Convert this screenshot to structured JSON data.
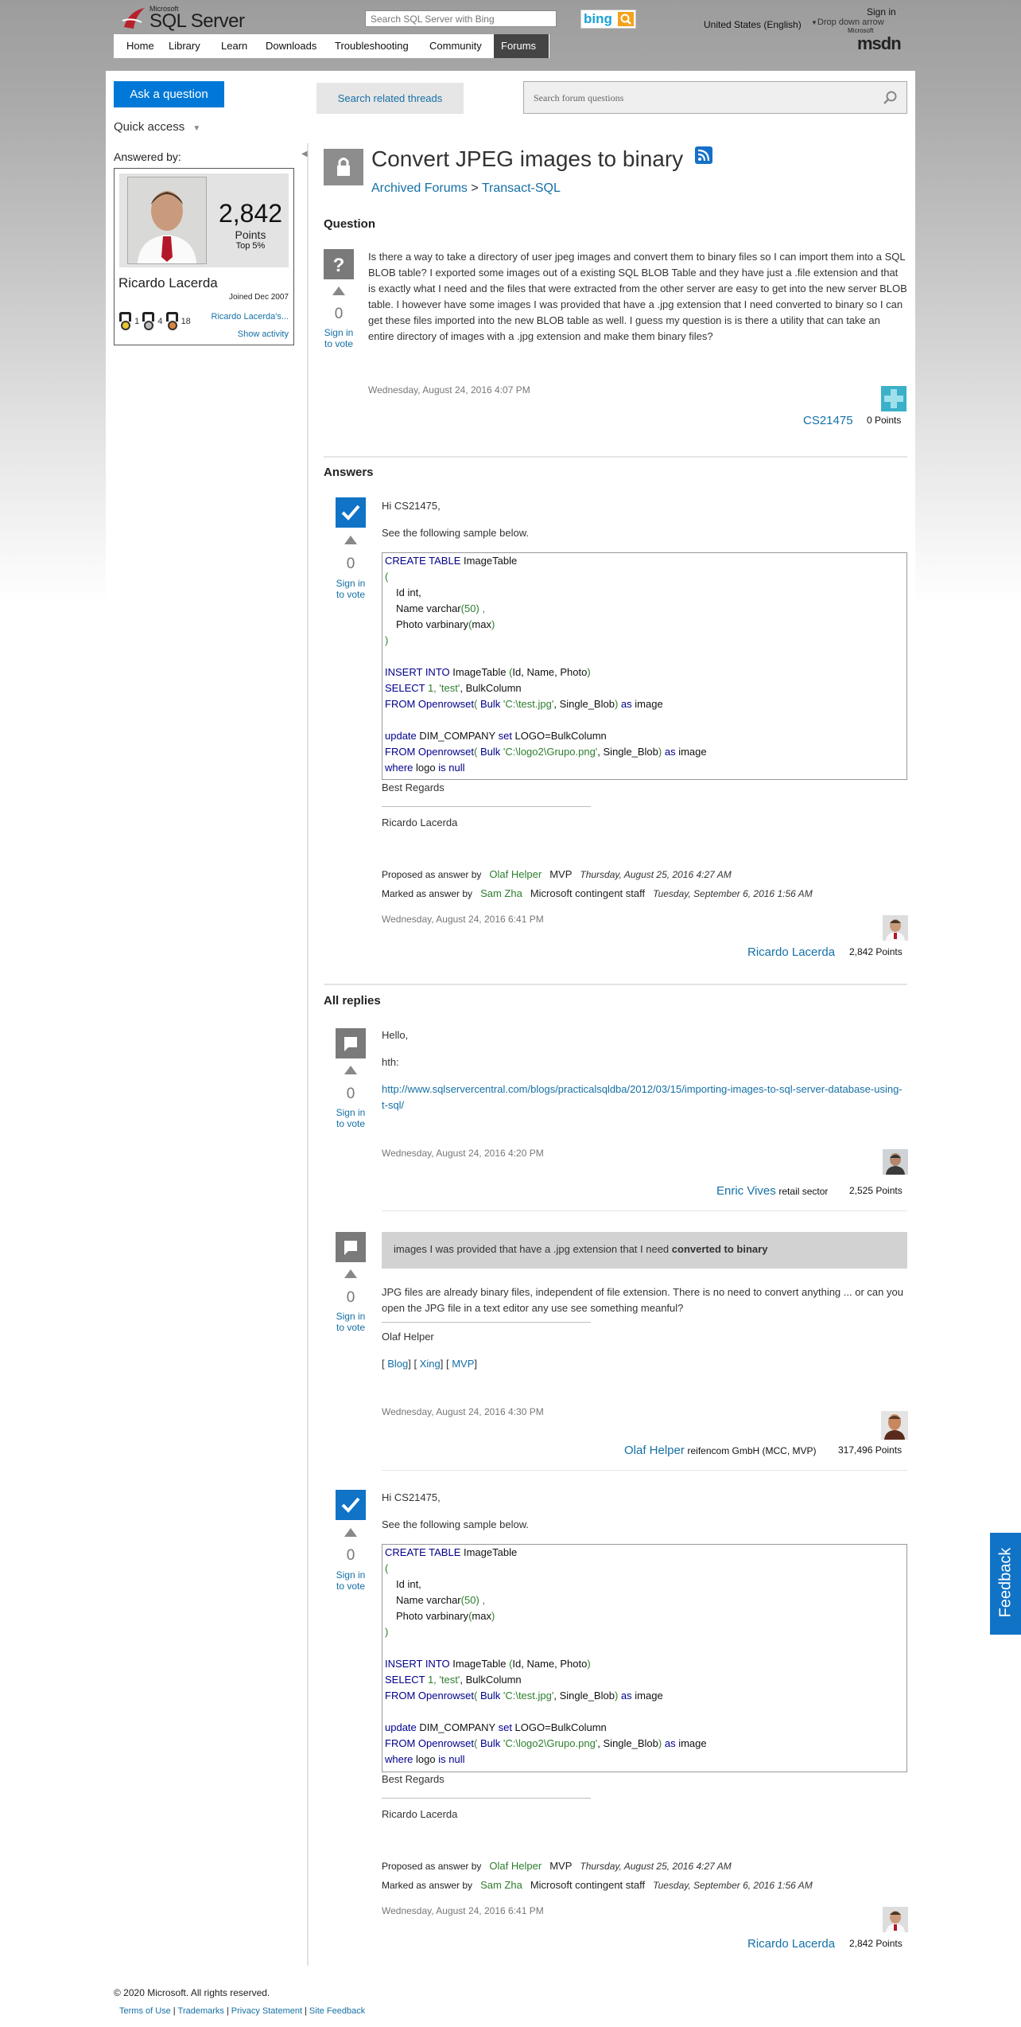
{
  "header": {
    "brand_small": "Microsoft",
    "brand": "SQL Server",
    "search_placeholder": "Search SQL Server with Bing",
    "bing_label": "bing",
    "signin": "Sign in",
    "locale": "United States (English)",
    "dropdown_alt": "Drop down arrow",
    "msdn_small": "Microsoft",
    "msdn": "msdn"
  },
  "nav": [
    "Home",
    "Library",
    "Learn",
    "Downloads",
    "Troubleshooting",
    "Community",
    "Forums"
  ],
  "toolbar": {
    "ask": "Ask a question",
    "search_threads": "Search related threads",
    "forum_search_placeholder": "Search forum questions",
    "quick_access": "Quick access"
  },
  "answered_by": {
    "label": "Answered by:",
    "points": "2,842",
    "points_label": "Points",
    "top": "Top 5%",
    "name": "Ricardo Lacerda",
    "joined": "Joined Dec 2007",
    "medals": [
      "1",
      "4",
      "18"
    ],
    "profile_link": "Ricardo Lacerda's...",
    "show_activity": "Show activity"
  },
  "question": {
    "title": "Convert JPEG images to binary",
    "breadcrumb_a": "Archived Forums",
    "breadcrumb_sep": " > ",
    "breadcrumb_b": "Transact-SQL",
    "section": "Question",
    "votes": "0",
    "sign_in": "Sign in to vote",
    "body": "Is there a way to take a directory of user jpeg images and convert them to binary files so I can import them into a SQL BLOB table?  I exported some images out of a existing SQL BLOB Table and they have just a .file extension and that is exactly what I need and the files that were extracted from the other server are easy to get into the new server BLOB table.  I however have some images I was provided that have a  .jpg extension that I need converted to binary so I can get these files imported into the new BLOB table as well.  I guess my question is is there a utility that can take an entire directory of images with a .jpg extension and make them binary files?",
    "date": "Wednesday, August 24, 2016 4:07 PM",
    "author": "CS21475",
    "points": "0 Points"
  },
  "answers": {
    "section": "Answers",
    "all_replies": "All replies"
  },
  "answer": {
    "votes": "0",
    "sign_in": "Sign in to vote",
    "greeting": "Hi CS21475,",
    "intro": "See the following sample below.",
    "best": "Best Regards",
    "signature": "Ricardo Lacerda",
    "proposed_label": "Proposed as answer by",
    "proposed_by": "Olaf Helper",
    "proposed_role": "MVP",
    "proposed_date": "Thursday, August 25, 2016 4:27 AM",
    "marked_label": "Marked as answer by",
    "marked_by": "Sam Zha",
    "marked_role": "Microsoft contingent staff",
    "marked_date": "Tuesday, September 6, 2016 1:56 AM",
    "date": "Wednesday, August 24, 2016 6:41 PM",
    "author": "Ricardo Lacerda",
    "points": "2,842 Points"
  },
  "code": {
    "l1a": "CREATE TABLE",
    "l1b": " ImageTable",
    "l2": "(",
    "l3": "Id int,",
    "l4a": "Name varchar",
    "l4b": "(",
    "l4c": "50",
    "l4d": ") ,",
    "l5a": "Photo varbinary",
    "l5b": "(",
    "l5c": "max",
    "l5d": ")",
    "l6": ")",
    "l7a": "INSERT INTO",
    "l7b": " ImageTable ",
    "l7c": "(",
    "l7d": "Id, Name, Photo",
    "l7e": ")",
    "l8a": "SELECT",
    "l8b": " 1, ",
    "l8c": "'test'",
    "l8d": ", BulkColumn",
    "l9a": "FROM",
    "l9b": " Openrowset",
    "l9c": "( ",
    "l9d": "Bulk",
    "l9e": " 'C:\\test.jpg'",
    "l9f": ", Single_Blob",
    "l9g": ") ",
    "l9h": "as",
    "l9i": " image",
    "l10a": "update",
    "l10b": " DIM_COMPANY ",
    "l10c": "set",
    "l10d": " LOGO=BulkColumn",
    "l11a": "FROM",
    "l11b": " Openrowset",
    "l11c": "( ",
    "l11d": "Bulk",
    "l11e": " 'C:\\logo2\\Grupo.png'",
    "l11f": ", Single_Blob",
    "l11g": ") ",
    "l11h": "as",
    "l11i": " image",
    "l12a": "where",
    "l12b": " logo ",
    "l12c": "is",
    "l12d": " null"
  },
  "reply1": {
    "votes": "0",
    "sign_in": "Sign in to vote",
    "greeting": "Hello,",
    "hth": "hth:",
    "link": "http://www.sqlservercentral.com/blogs/practicalsqldba/2012/03/15/importing-images-to-sql-server-database-using-t-sql/",
    "date": "Wednesday, August 24, 2016 4:20 PM",
    "author": "Enric Vives",
    "role": "retail sector",
    "points": "2,525 Points"
  },
  "reply2": {
    "votes": "0",
    "sign_in": "Sign in to vote",
    "quote_a": "images I was provided that have a  .jpg extension that I need ",
    "quote_b": "converted to binary",
    "body": "JPG files are already binary files, independent of file extension. There is no need to convert anything ... or can you open the JPG file in a text editor any use see something meanful?",
    "signature": "Olaf Helper",
    "blog": "Blog",
    "xing": "Xing",
    "mvp": "MVP",
    "date": "Wednesday, August 24, 2016 4:30 PM",
    "author": "Olaf Helper",
    "role": "reifencom GmbH (MCC, MVP)",
    "points": "317,496 Points"
  },
  "footer": {
    "copyright": "© 2020 Microsoft. All rights reserved.",
    "links": [
      "Terms of Use",
      "Trademarks",
      "Privacy Statement",
      "Site Feedback"
    ]
  },
  "feedback": "Feedback"
}
